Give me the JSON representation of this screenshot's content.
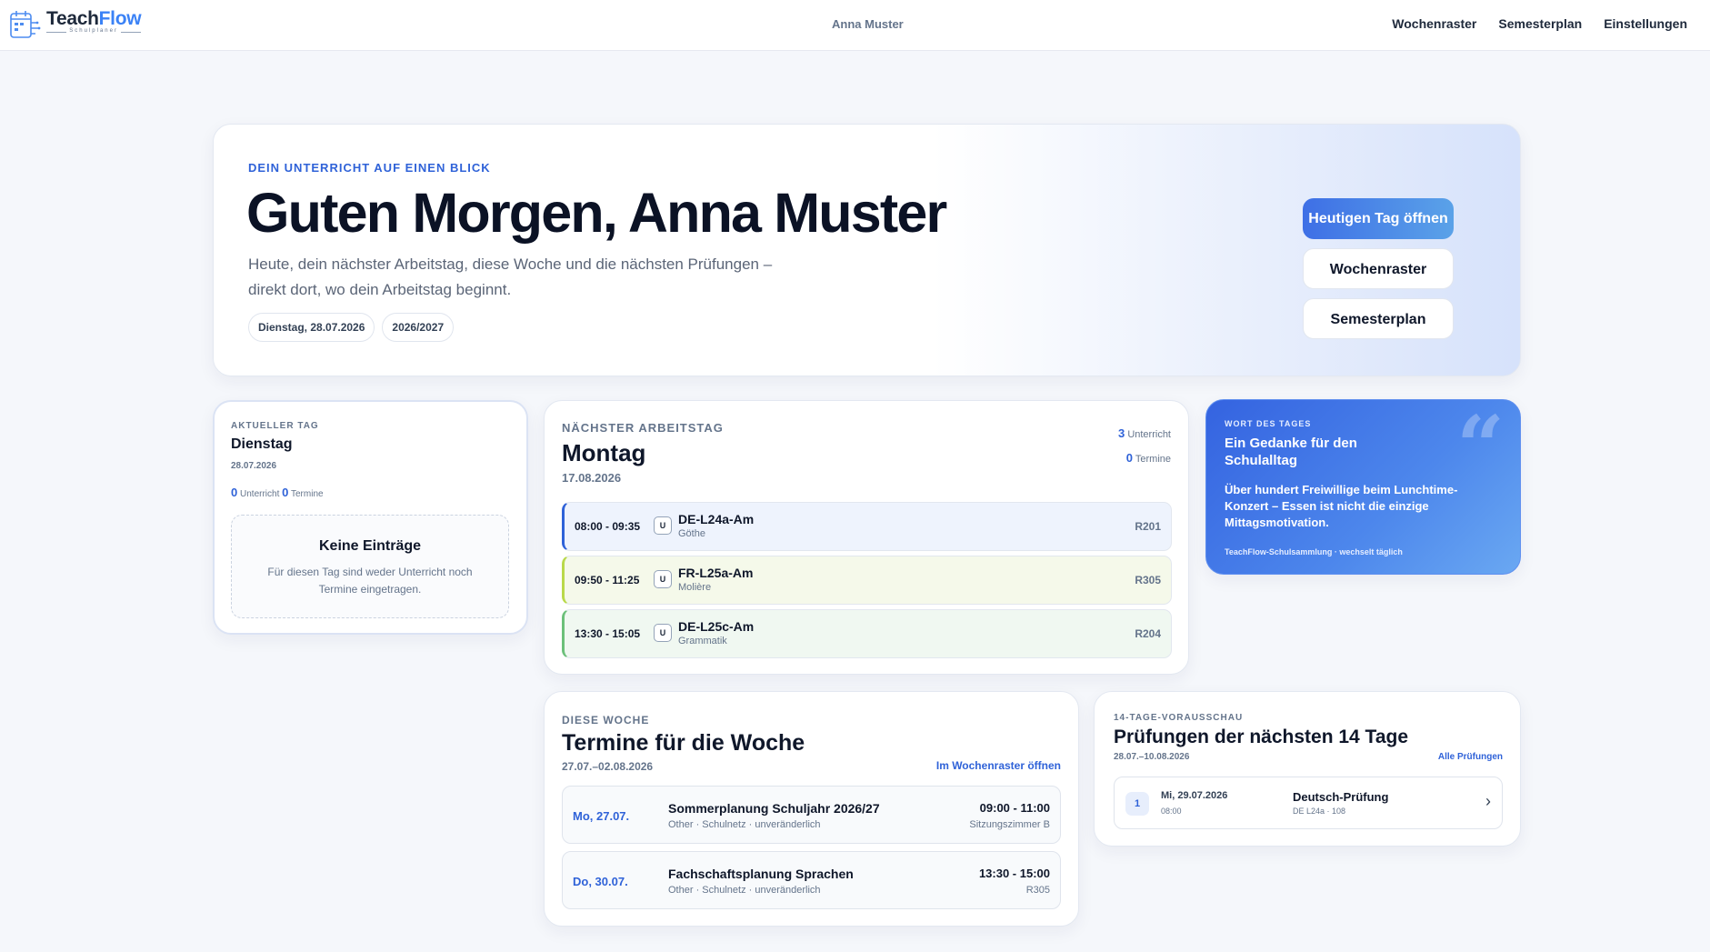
{
  "nav": {
    "brand_part1": "Teach",
    "brand_part2": "Flow",
    "brand_sub": "Schulplaner",
    "user": "Anna Muster",
    "links": [
      "Wochenraster",
      "Semesterplan",
      "Einstellungen"
    ]
  },
  "hero": {
    "eyebrow": "DEIN UNTERRICHT AUF EINEN BLICK",
    "title": "Guten Morgen, Anna Muster",
    "subtitle": "Heute, dein nächster Arbeitstag, diese Woche und die nächsten Prüfungen – direkt dort, wo dein Arbeitstag beginnt.",
    "chip_date": "Dienstag, 28.07.2026",
    "chip_year": "2026/2027",
    "btn_today": "Heutigen Tag öffnen",
    "btn_week": "Wochenraster",
    "btn_semester": "Semesterplan"
  },
  "today": {
    "label": "AKTUELLER TAG",
    "day": "Dienstag",
    "date": "28.07.2026",
    "lessons_count": "0",
    "lessons_label": "Unterricht",
    "events_count": "0",
    "events_label": "Termine",
    "empty_title": "Keine Einträge",
    "empty_text": "Für diesen Tag sind weder Unterricht noch Termine eingetragen."
  },
  "next": {
    "label": "NÄCHSTER ARBEITSTAG",
    "day": "Montag",
    "date": "17.08.2026",
    "lessons_count": "3",
    "lessons_label": "Unterricht",
    "events_count": "0",
    "events_label": "Termine",
    "lessons": [
      {
        "time": "08:00 - 09:35",
        "badge": "U",
        "name": "DE-L24a-Am",
        "sub": "Göthe",
        "room": "R201",
        "color": "#2f62d8",
        "bg": "#eef3fd"
      },
      {
        "time": "09:50 - 11:25",
        "badge": "U",
        "name": "FR-L25a-Am",
        "sub": "Molière",
        "room": "R305",
        "color": "#b9d94a",
        "bg": "#f5f9ea"
      },
      {
        "time": "13:30 - 15:05",
        "badge": "U",
        "name": "DE-L25c-Am",
        "sub": "Grammatik",
        "room": "R204",
        "color": "#6cc07a",
        "bg": "#f0f8f1"
      }
    ]
  },
  "quote": {
    "label": "WORT DES TAGES",
    "title": "Ein Gedanke für den Schulalltag",
    "mark": "“",
    "text": "Über hundert Freiwillige beim Lunchtime-Konzert – Essen ist nicht die einzige Mittagsmotivation.",
    "source": "TeachFlow-Schulsammlung · wechselt täglich"
  },
  "week": {
    "label": "DIESE WOCHE",
    "title": "Termine für die Woche",
    "range": "27.07.–02.08.2026",
    "link": "Im Wochenraster öffnen",
    "items": [
      {
        "day": "Mo, 27.07.",
        "title": "Sommerplanung Schuljahr 2026/27",
        "sub": "Other · Schulnetz · unveränderlich",
        "time": "09:00 - 11:00",
        "room": "Sitzungszimmer B"
      },
      {
        "day": "Do, 30.07.",
        "title": "Fachschaftsplanung Sprachen",
        "sub": "Other · Schulnetz · unveränderlich",
        "time": "13:30 - 15:00",
        "room": "R305"
      }
    ]
  },
  "exams": {
    "label": "14-TAGE-VORAUSSCHAU",
    "title": "Prüfungen der nächsten 14 Tage",
    "range": "28.07.–10.08.2026",
    "link": "Alle Prüfungen",
    "item": {
      "num": "1",
      "date": "Mi, 29.07.2026",
      "time": "08:00",
      "name": "Deutsch-Prüfung",
      "sub": "DE L24a · 108",
      "chevron": "›"
    }
  }
}
